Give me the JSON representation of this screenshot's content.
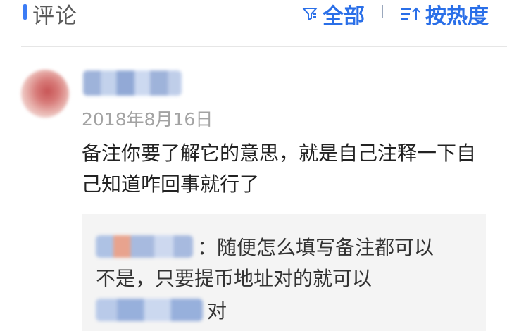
{
  "header": {
    "title": "评论",
    "filter": {
      "label": "全部",
      "icon": "filter-icon"
    },
    "sort": {
      "label": "按热度",
      "icon": "sort-icon"
    },
    "accent_color": "#3b7cf5",
    "link_color": "#2a6fe8"
  },
  "comment": {
    "date": "2018年8月16日",
    "text": "备注你要了解它的意思，就是自己注释一下自己知道咋回事就行了"
  },
  "replies": [
    {
      "text": "：随便怎么填写备注都可以"
    },
    {
      "text": "不是，只要提币地址对的就可以"
    },
    {
      "text": "对"
    }
  ]
}
